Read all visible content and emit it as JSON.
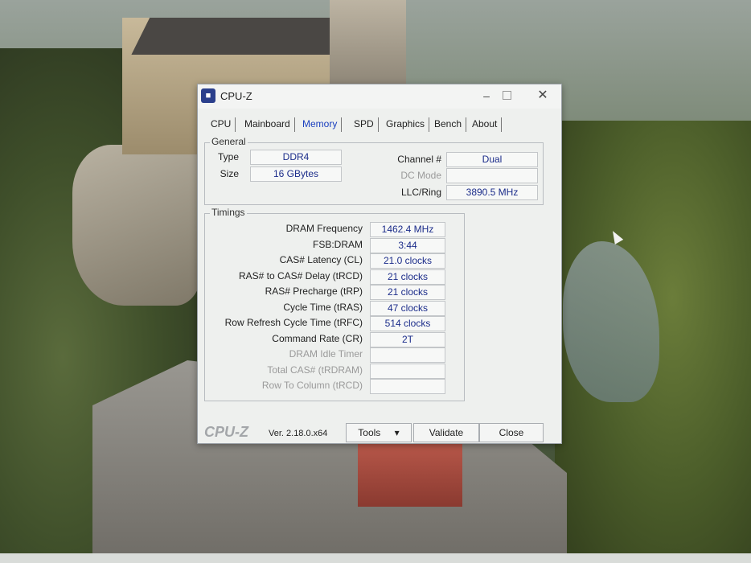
{
  "window": {
    "title": "CPU-Z"
  },
  "tabs": [
    {
      "label": "CPU"
    },
    {
      "label": "Mainboard"
    },
    {
      "label": "Memory"
    },
    {
      "label": "SPD"
    },
    {
      "label": "Graphics"
    },
    {
      "label": "Bench"
    },
    {
      "label": "About"
    }
  ],
  "active_tab": "Memory",
  "general": {
    "group_label": "General",
    "type_label": "Type",
    "type_value": "DDR4",
    "size_label": "Size",
    "size_value": "16 GBytes",
    "channel_label": "Channel #",
    "channel_value": "Dual",
    "dc_mode_label": "DC Mode",
    "dc_mode_value": "",
    "llc_label": "LLC/Ring",
    "llc_value": "3890.5 MHz"
  },
  "timings": {
    "group_label": "Timings",
    "rows": [
      {
        "label": "DRAM Frequency",
        "value": "1462.4 MHz",
        "dim": false
      },
      {
        "label": "FSB:DRAM",
        "value": "3:44",
        "dim": false
      },
      {
        "label": "CAS# Latency (CL)",
        "value": "21.0 clocks",
        "dim": false
      },
      {
        "label": "RAS# to CAS# Delay (tRCD)",
        "value": "21 clocks",
        "dim": false
      },
      {
        "label": "RAS# Precharge (tRP)",
        "value": "21 clocks",
        "dim": false
      },
      {
        "label": "Cycle Time (tRAS)",
        "value": "47 clocks",
        "dim": false
      },
      {
        "label": "Row Refresh Cycle Time (tRFC)",
        "value": "514 clocks",
        "dim": false
      },
      {
        "label": "Command Rate (CR)",
        "value": "2T",
        "dim": false
      },
      {
        "label": "DRAM Idle Timer",
        "value": "",
        "dim": true
      },
      {
        "label": "Total CAS# (tRDRAM)",
        "value": "",
        "dim": true
      },
      {
        "label": "Row To Column (tRCD)",
        "value": "",
        "dim": true
      }
    ]
  },
  "footer": {
    "logo": "CPU-Z",
    "version": "Ver. 2.18.0.x64",
    "tools_label": "Tools",
    "validate_label": "Validate",
    "close_label": "Close"
  },
  "colors": {
    "value_text": "#1b2c8a",
    "active_tab": "#1a3fbf"
  }
}
